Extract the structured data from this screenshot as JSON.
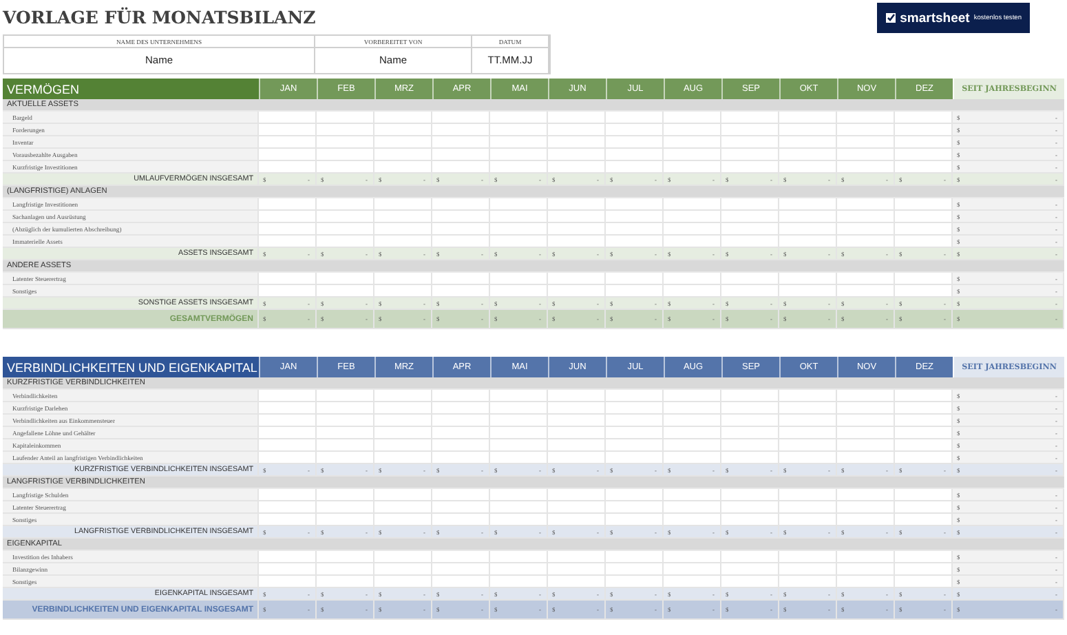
{
  "title": "VORLAGE FÜR MONATSBILANZ",
  "info": [
    {
      "label": "NAME DES UNTERNEHMENS",
      "value": "Name"
    },
    {
      "label": "VORBEREITET VON",
      "value": "Name"
    },
    {
      "label": "DATUM",
      "value": "TT.MM.JJ"
    }
  ],
  "logo": {
    "name": "smartsheet",
    "tagline": "kostenlos testen"
  },
  "sections": [
    {
      "title": "VERMÖGEN",
      "color": "#548235",
      "months": [
        "JAN",
        "FEB",
        "MRZ",
        "APR",
        "MAI",
        "JUN",
        "JUL",
        "AUG",
        "SEP",
        "OKT",
        "NOV",
        "DEZ"
      ],
      "ytd_header": "SEIT JAHRESBEGINN",
      "rows": [
        {
          "kind": "header",
          "label": "AKTUELLE ASSETS"
        },
        {
          "kind": "item",
          "label": "Bargeld",
          "ytd": [
            "$",
            "-"
          ]
        },
        {
          "kind": "item",
          "label": "Forderungen",
          "ytd": [
            "$",
            "-"
          ]
        },
        {
          "kind": "item",
          "label": "Inventar",
          "ytd": [
            "$",
            "-"
          ]
        },
        {
          "kind": "item",
          "label": "Vorausbezahlte Ausgaben",
          "ytd": [
            "$",
            "-"
          ]
        },
        {
          "kind": "item",
          "label": "Kurzfristige Investitionen",
          "ytd": [
            "$",
            "-"
          ]
        },
        {
          "kind": "total",
          "label": "UMLAUFVERMÖGEN INSGESAMT",
          "months": [
            [
              "$",
              "-"
            ],
            [
              "$",
              "-"
            ],
            [
              "$",
              "-"
            ],
            [
              "$",
              "-"
            ],
            [
              "$",
              "-"
            ],
            [
              "$",
              "-"
            ],
            [
              "$",
              "-"
            ],
            [
              "$",
              "-"
            ],
            [
              "$",
              "-"
            ],
            [
              "$",
              "-"
            ],
            [
              "$",
              "-"
            ],
            [
              "$",
              "-"
            ]
          ],
          "ytd": [
            "$",
            "-"
          ]
        },
        {
          "kind": "header",
          "label": "(LANGFRISTIGE) ANLAGEN"
        },
        {
          "kind": "item",
          "label": "Langfristige Investitionen",
          "ytd": [
            "$",
            "-"
          ]
        },
        {
          "kind": "item",
          "label": "Sachanlagen und Ausrüstung",
          "ytd": [
            "$",
            "-"
          ]
        },
        {
          "kind": "item",
          "label": "(Abzüglich der kumulierten Abschreibung)",
          "ytd": [
            "$",
            "-"
          ]
        },
        {
          "kind": "item",
          "label": "Immaterielle Assets",
          "ytd": [
            "$",
            "-"
          ]
        },
        {
          "kind": "total",
          "label": "ASSETS INSGESAMT",
          "months": [
            [
              "$",
              "-"
            ],
            [
              "$",
              "-"
            ],
            [
              "$",
              "-"
            ],
            [
              "$",
              "-"
            ],
            [
              "$",
              "-"
            ],
            [
              "$",
              "-"
            ],
            [
              "$",
              "-"
            ],
            [
              "$",
              "-"
            ],
            [
              "$",
              "-"
            ],
            [
              "$",
              "-"
            ],
            [
              "$",
              "-"
            ],
            [
              "$",
              "-"
            ]
          ],
          "ytd": [
            "$",
            "-"
          ]
        },
        {
          "kind": "header",
          "label": "ANDERE ASSETS"
        },
        {
          "kind": "item",
          "label": "Latenter Steuerertrag",
          "ytd": [
            "$",
            "-"
          ]
        },
        {
          "kind": "item",
          "label": "Sonstiges",
          "ytd": [
            "$",
            "-"
          ]
        },
        {
          "kind": "total",
          "label": "SONSTIGE ASSETS INSGESAMT",
          "months": [
            [
              "$",
              "-"
            ],
            [
              "$",
              "-"
            ],
            [
              "$",
              "-"
            ],
            [
              "$",
              "-"
            ],
            [
              "$",
              "-"
            ],
            [
              "$",
              "-"
            ],
            [
              "$",
              "-"
            ],
            [
              "$",
              "-"
            ],
            [
              "$",
              "-"
            ],
            [
              "$",
              "-"
            ],
            [
              "$",
              "-"
            ],
            [
              "$",
              "-"
            ]
          ],
          "ytd": [
            "$",
            "-"
          ]
        },
        {
          "kind": "grand",
          "label": "GESAMTVERMÖGEN",
          "months": [
            [
              "$",
              "-"
            ],
            [
              "$",
              "-"
            ],
            [
              "$",
              "-"
            ],
            [
              "$",
              "-"
            ],
            [
              "$",
              "-"
            ],
            [
              "$",
              "-"
            ],
            [
              "$",
              "-"
            ],
            [
              "$",
              "-"
            ],
            [
              "$",
              "-"
            ],
            [
              "$",
              "-"
            ],
            [
              "$",
              "-"
            ],
            [
              "$",
              "-"
            ]
          ],
          "ytd": [
            "$",
            "-"
          ]
        }
      ]
    },
    {
      "title": "VERBINDLICHKEITEN UND EIGENKAPITAL",
      "color": "#2f5597",
      "months": [
        "JAN",
        "FEB",
        "MRZ",
        "APR",
        "MAI",
        "JUN",
        "JUL",
        "AUG",
        "SEP",
        "OKT",
        "NOV",
        "DEZ"
      ],
      "ytd_header": "SEIT JAHRESBEGINN",
      "rows": [
        {
          "kind": "header",
          "label": "KURZFRISTIGE VERBINDLICHKEITEN"
        },
        {
          "kind": "item",
          "label": "Verbindlichkeiten",
          "ytd": [
            "$",
            "-"
          ]
        },
        {
          "kind": "item",
          "label": "Kurzfristige Darlehen",
          "ytd": [
            "$",
            "-"
          ]
        },
        {
          "kind": "item",
          "label": "Verbindlichkeiten aus Einkommensteuer",
          "ytd": [
            "$",
            "-"
          ]
        },
        {
          "kind": "item",
          "label": "Angefallene Löhne und Gehälter",
          "ytd": [
            "$",
            "-"
          ]
        },
        {
          "kind": "item",
          "label": "Kapitaleinkommen",
          "ytd": [
            "$",
            "-"
          ]
        },
        {
          "kind": "item",
          "label": "Laufender Anteil an langfristigen Verbindlichkeiten",
          "ytd": [
            "$",
            "-"
          ]
        },
        {
          "kind": "total",
          "label": "KURZFRISTIGE VERBINDLICHKEITEN INSGESAMT",
          "months": [
            [
              "$",
              "-"
            ],
            [
              "$",
              "-"
            ],
            [
              "$",
              "-"
            ],
            [
              "$",
              "-"
            ],
            [
              "$",
              "-"
            ],
            [
              "$",
              "-"
            ],
            [
              "$",
              "-"
            ],
            [
              "$",
              "-"
            ],
            [
              "$",
              "-"
            ],
            [
              "$",
              "-"
            ],
            [
              "$",
              "-"
            ],
            [
              "$",
              "-"
            ]
          ],
          "ytd": [
            "$",
            "-"
          ]
        },
        {
          "kind": "header",
          "label": "LANGFRISTIGE VERBINDLICHKEITEN"
        },
        {
          "kind": "item",
          "label": "Langfristige Schulden",
          "ytd": [
            "$",
            "-"
          ]
        },
        {
          "kind": "item",
          "label": "Latenter Steuerertrag",
          "ytd": [
            "$",
            "-"
          ]
        },
        {
          "kind": "item",
          "label": "Sonstiges",
          "ytd": [
            "$",
            "-"
          ]
        },
        {
          "kind": "total",
          "label": "LANGFRISTIGE VERBINDLICHKEITEN INSGESAMT",
          "months": [
            [
              "$",
              "-"
            ],
            [
              "$",
              "-"
            ],
            [
              "$",
              "-"
            ],
            [
              "$",
              "-"
            ],
            [
              "$",
              "-"
            ],
            [
              "$",
              "-"
            ],
            [
              "$",
              "-"
            ],
            [
              "$",
              "-"
            ],
            [
              "$",
              "-"
            ],
            [
              "$",
              "-"
            ],
            [
              "$",
              "-"
            ],
            [
              "$",
              "-"
            ]
          ],
          "ytd": [
            "$",
            "-"
          ]
        },
        {
          "kind": "header",
          "label": "EIGENKAPITAL"
        },
        {
          "kind": "item",
          "label": "Investition des Inhabers",
          "ytd": [
            "$",
            "-"
          ]
        },
        {
          "kind": "item",
          "label": "Bilanzgewinn",
          "ytd": [
            "$",
            "-"
          ]
        },
        {
          "kind": "item",
          "label": "Sonstiges",
          "ytd": [
            "$",
            "-"
          ]
        },
        {
          "kind": "total",
          "label": "EIGENKAPITAL INSGESAMT",
          "months": [
            [
              "$",
              "-"
            ],
            [
              "$",
              "-"
            ],
            [
              "$",
              "-"
            ],
            [
              "$",
              "-"
            ],
            [
              "$",
              "-"
            ],
            [
              "$",
              "-"
            ],
            [
              "$",
              "-"
            ],
            [
              "$",
              "-"
            ],
            [
              "$",
              "-"
            ],
            [
              "$",
              "-"
            ],
            [
              "$",
              "-"
            ],
            [
              "$",
              "-"
            ]
          ],
          "ytd": [
            "$",
            "-"
          ]
        },
        {
          "kind": "grand",
          "label": "VERBINDLICHKEITEN UND EIGENKAPITAL INSGESAMT",
          "months": [
            [
              "$",
              "-"
            ],
            [
              "$",
              "-"
            ],
            [
              "$",
              "-"
            ],
            [
              "$",
              "-"
            ],
            [
              "$",
              "-"
            ],
            [
              "$",
              "-"
            ],
            [
              "$",
              "-"
            ],
            [
              "$",
              "-"
            ],
            [
              "$",
              "-"
            ],
            [
              "$",
              "-"
            ],
            [
              "$",
              "-"
            ],
            [
              "$",
              "-"
            ]
          ],
          "ytd": [
            "$",
            "-"
          ]
        }
      ]
    }
  ]
}
